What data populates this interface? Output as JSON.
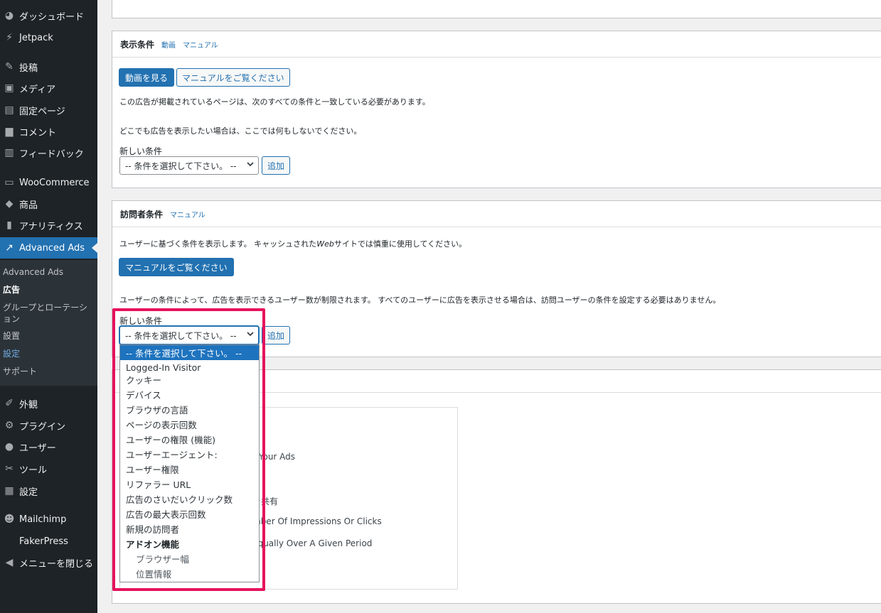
{
  "sidebar": {
    "items": [
      {
        "icon": "dashboard-icon",
        "glyph": "◕",
        "label": "ダッシュボード"
      },
      {
        "icon": "jetpack-icon",
        "glyph": "⚡",
        "label": "Jetpack"
      },
      {
        "icon": "pin-icon",
        "glyph": "✎",
        "label": "投稿"
      },
      {
        "icon": "media-icon",
        "glyph": "▣",
        "label": "メディア"
      },
      {
        "icon": "page-icon",
        "glyph": "▤",
        "label": "固定ページ"
      },
      {
        "icon": "comment-icon",
        "glyph": "▆",
        "label": "コメント"
      },
      {
        "icon": "feedback-icon",
        "glyph": "▥",
        "label": "フィードバック"
      },
      {
        "icon": "woocommerce-icon",
        "glyph": "▭",
        "label": "WooCommerce"
      },
      {
        "icon": "products-icon",
        "glyph": "◆",
        "label": "商品"
      },
      {
        "icon": "analytics-icon",
        "glyph": "▮",
        "label": "アナリティクス"
      },
      {
        "icon": "advanced-ads-icon",
        "glyph": "↗",
        "label": "Advanced Ads"
      },
      {
        "icon": "appearance-icon",
        "glyph": "✐",
        "label": "外観"
      },
      {
        "icon": "plugin-icon",
        "glyph": "⚙",
        "label": "プラグイン"
      },
      {
        "icon": "users-icon",
        "glyph": "●",
        "label": "ユーザー"
      },
      {
        "icon": "tools-icon",
        "glyph": "✂",
        "label": "ツール"
      },
      {
        "icon": "settings-icon",
        "glyph": "▦",
        "label": "設定"
      },
      {
        "icon": "mailchimp-icon",
        "glyph": "☻",
        "label": "Mailchimp"
      },
      {
        "icon": "",
        "glyph": "",
        "label": "FakerPress"
      },
      {
        "icon": "collapse-icon",
        "glyph": "◀",
        "label": "メニューを閉じる"
      }
    ],
    "submenu": [
      "Advanced Ads",
      "広告",
      "グループとローテーション",
      "設置",
      "設定",
      "サポート"
    ]
  },
  "display_box": {
    "title": "表示条件",
    "links": [
      "動画",
      "マニュアル"
    ],
    "video_button": "動画を見る",
    "manual_button": "マニュアルをご覧ください",
    "text1": "この広告が掲載されているページは、次のすべての条件と一致している必要があります。",
    "text2": "どこでも広告を表示したい場合は、ここでは何もしないでください。",
    "new_condition_label": "新しい条件",
    "select_value": "-- 条件を選択して下さい。 --",
    "add_button": "追加"
  },
  "visitor_box": {
    "title": "訪問者条件",
    "link": "マニュアル",
    "text1_a": "ユーザーに基づく条件を表示します。 キャッシュされた",
    "text1_em": "Web",
    "text1_b": "サイトでは慎重に使用してください。",
    "manual_button": "マニュアルをご覧ください",
    "text2": "ユーザーの条件によって、広告を表示できるユーザー数が制限されます。 すべてのユーザーに広告を表示させる場合は、訪問ユーザーの条件を設定する必要はありません。",
    "new_condition_label": "新しい条件",
    "select_value": "-- 条件を選択して下さい。 --",
    "add_button": "追加"
  },
  "background_text": [
    "r Your Ads",
    "を共有",
    "mber Of Impressions Or Clicks",
    "Equally Over A Given Period"
  ],
  "dropdown": {
    "options": [
      {
        "label": "-- 条件を選択して下さい。 --",
        "kind": "sel"
      },
      {
        "label": "Logged-In Visitor",
        "kind": "opt"
      },
      {
        "label": "クッキー",
        "kind": "opt"
      },
      {
        "label": "デバイス",
        "kind": "opt"
      },
      {
        "label": "ブラウザの言語",
        "kind": "opt"
      },
      {
        "label": "ページの表示回数",
        "kind": "opt"
      },
      {
        "label": "ユーザーの権限 (機能)",
        "kind": "opt"
      },
      {
        "label": "ユーザーエージェント:",
        "kind": "opt"
      },
      {
        "label": "ユーザー権限",
        "kind": "opt"
      },
      {
        "label": "リファラー URL",
        "kind": "opt"
      },
      {
        "label": "広告のさいだいクリック数",
        "kind": "opt"
      },
      {
        "label": "広告の最大表示回数",
        "kind": "opt"
      },
      {
        "label": "新規の訪問者",
        "kind": "opt"
      },
      {
        "label": "アドオン機能",
        "kind": "group"
      },
      {
        "label": "ブラウザー幅",
        "kind": "indent"
      },
      {
        "label": "位置情報",
        "kind": "indent"
      }
    ]
  },
  "colors": {
    "sidebar_bg": "#1d2327",
    "accent": "#2271b1",
    "highlight": "#e6135c"
  }
}
